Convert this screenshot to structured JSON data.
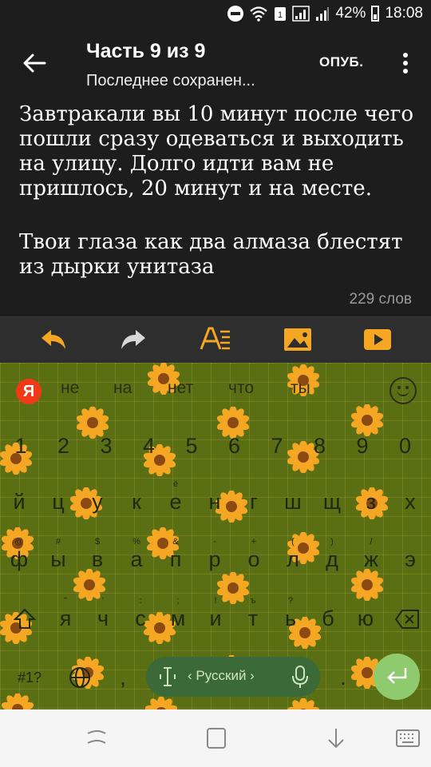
{
  "status": {
    "battery": "42%",
    "time": "18:08"
  },
  "appbar": {
    "title": "Часть 9 из 9",
    "subtitle": "Последнее сохранен...",
    "publish_label": "ОПУБ."
  },
  "editor": {
    "paragraphs": [
      "Завтракали вы 10 минут после чего пошли сразу одеваться и выходить на улицу. Долго идти вам не пришлось, 20 минут и на месте.",
      "Твои глаза как два алмаза блестят из дырки унитаза"
    ],
    "word_count": "229 слов"
  },
  "toolbar": {
    "icons": [
      "undo-icon",
      "redo-icon",
      "text-format-icon",
      "image-icon",
      "video-icon"
    ]
  },
  "keyboard": {
    "yandex_label": "Я",
    "suggestions": [
      "не",
      "на",
      "нет",
      "что",
      "ты"
    ],
    "number_row": [
      "1",
      "2",
      "3",
      "4",
      "5",
      "6",
      "7",
      "8",
      "9",
      "0"
    ],
    "row1": [
      "й",
      "ц",
      "у",
      "к",
      "е",
      "н",
      "г",
      "ш",
      "щ",
      "з",
      "х"
    ],
    "row1_hints": [
      "",
      "",
      "",
      "",
      "ё",
      "",
      "",
      "",
      "",
      "",
      ""
    ],
    "row2": [
      "ф",
      "ы",
      "в",
      "а",
      "п",
      "р",
      "о",
      "л",
      "д",
      "ж",
      "э"
    ],
    "row2_hints": [
      "@",
      "#",
      "$",
      "%",
      "&",
      "-",
      "+",
      "(",
      ")",
      "/",
      ""
    ],
    "row3": [
      "я",
      "ч",
      "с",
      "м",
      "и",
      "т",
      "ь",
      "б",
      "ю"
    ],
    "row3_hints": [
      "\"",
      "'",
      ":",
      ";",
      "!",
      "ъ",
      "?",
      "",
      ""
    ],
    "symbols_label": "#1?",
    "comma": ",",
    "period": ".",
    "language": "‹ Русский ›"
  },
  "colors": {
    "keyboard_bg": "#5a6e14",
    "enter": "#8fcb6e",
    "accent_orange": "#f5a623"
  }
}
